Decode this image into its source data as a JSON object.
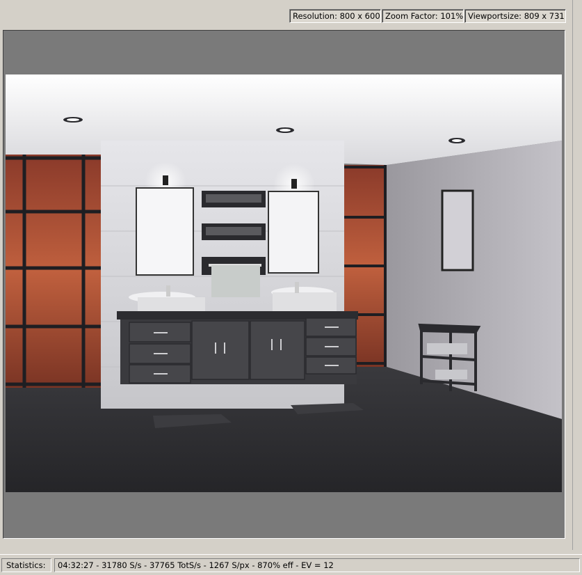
{
  "toolbar": {
    "resolution": "Resolution: 800 x 600",
    "zoom_factor": "Zoom Factor: 101%",
    "viewport_size": "Viewportsize: 809 x 731"
  },
  "render": {
    "subject": "bathroom-render",
    "scene_colors": {
      "ceiling": "#f4f4f6",
      "floor": "#2e2e32",
      "wall": "#a8a6ac",
      "partition": "#dcdce0",
      "cabinet": "#3a3a3e",
      "glass_shelf": "#b4533a",
      "frame": "#1e1e22"
    }
  },
  "status": {
    "label": "Statistics:",
    "value": "04:32:27 - 31780 S/s - 37765 TotS/s - 1267 S/px - 870% eff - EV = 12"
  }
}
